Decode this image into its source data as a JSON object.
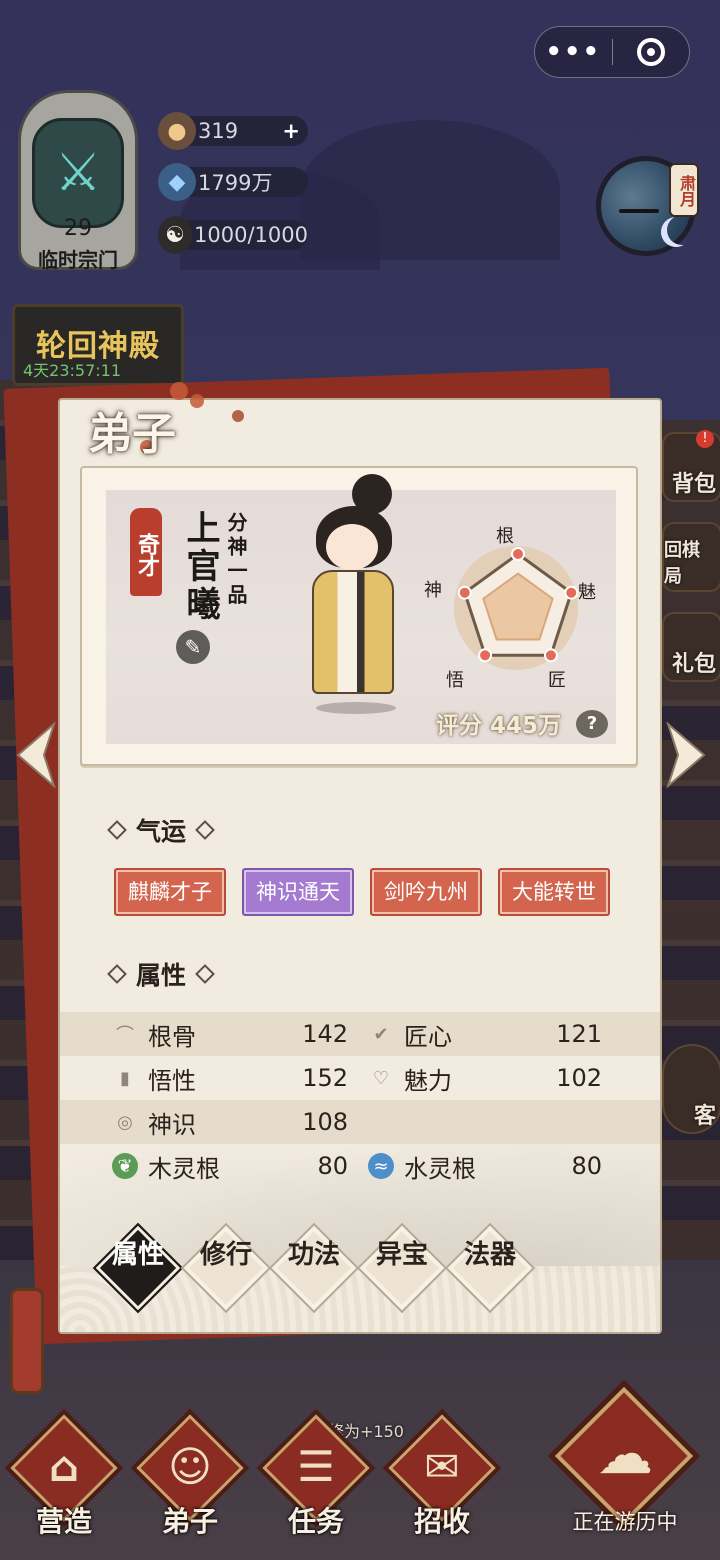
{
  "topbar": {
    "menu_dots": "•••",
    "target_icon": "target-icon"
  },
  "sect": {
    "level": "29",
    "name": "临时宗门"
  },
  "resources": [
    {
      "icon": "spirit-orb-icon",
      "value": "319",
      "plus": "+"
    },
    {
      "icon": "spirit-stone-icon",
      "value": "1799万"
    },
    {
      "icon": "taiji-icon",
      "value": "1000/1000"
    }
  ],
  "moon": {
    "tag": "肃月"
  },
  "event": {
    "title": "轮回神殿",
    "countdown": "4天23:57:11"
  },
  "side_menu": [
    {
      "label": "背包",
      "badge": "!"
    },
    {
      "label": "回棋局"
    },
    {
      "label": "礼包"
    },
    {
      "label": "客"
    }
  ],
  "panel": {
    "title": "弟子"
  },
  "disciple": {
    "tag": "奇才",
    "name": "上官曦",
    "rank": "分神一品",
    "brush_icon": "brush-icon",
    "score": "评分 445万",
    "help": "?"
  },
  "radar": {
    "labels": [
      "根",
      "魅",
      "匠",
      "悟",
      "神"
    ],
    "values": [
      0.65,
      0.65,
      0.65,
      0.65,
      0.65
    ]
  },
  "fortune": {
    "heading": "气运",
    "items": [
      {
        "label": "麒麟才子",
        "color": "#d3654f"
      },
      {
        "label": "神识通天",
        "color": "#a57bd1"
      },
      {
        "label": "剑吟九州",
        "color": "#d3654f"
      },
      {
        "label": "大能转世",
        "color": "#d3654f"
      }
    ]
  },
  "attributes": {
    "heading": "属性",
    "rows": [
      {
        "left": {
          "label": "根骨",
          "value": "142"
        },
        "right": {
          "label": "匠心",
          "value": "121"
        }
      },
      {
        "left": {
          "label": "悟性",
          "value": "152"
        },
        "right": {
          "label": "魅力",
          "value": "102"
        }
      },
      {
        "left": {
          "label": "神识",
          "value": "108"
        }
      },
      {
        "left": {
          "label": "木灵根",
          "value": "80"
        },
        "right": {
          "label": "水灵根",
          "value": "80"
        }
      }
    ]
  },
  "tabs": [
    "属性",
    "修行",
    "功法",
    "异宝",
    "法器"
  ],
  "bottom_nav": [
    {
      "label": "营造",
      "icon": "building-icon"
    },
    {
      "label": "弟子",
      "icon": "disciple-icon"
    },
    {
      "label": "任务",
      "icon": "task-icon"
    },
    {
      "label": "招收",
      "icon": "recruit-icon"
    }
  ],
  "travel": {
    "label": "正在游历中"
  },
  "power_text": "修为+150"
}
